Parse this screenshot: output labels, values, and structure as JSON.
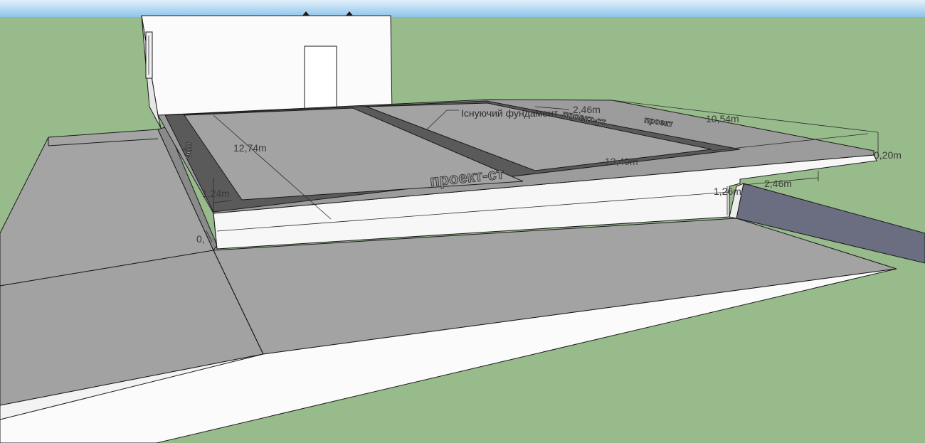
{
  "scene": {
    "colors": {
      "sky_top": "#e2f0fa",
      "sky_bottom": "#8ec3ea",
      "ground": "#97bb8b",
      "slab_top": "#9c9c9c",
      "slab_side": "#f7f7f7",
      "recess": "#a3a3a3",
      "border_strip": "#5a5a5a",
      "shadow_face": "#6b6e80",
      "wall": "#fbfbfb"
    }
  },
  "labels": {
    "leader_note": "Існуючий фундамент"
  },
  "dimensions": {
    "d_12_74": "12,74m",
    "d_2_46_top": "2,46m",
    "d_10_54": "10,54m",
    "d_0_20": "0,20m",
    "d_13_40": "13,40m",
    "d_1_24": "1,24m",
    "d_0_x": "0,",
    "d_1_26": "1,26m",
    "d_2_46_right": "2,46m"
  },
  "engraved_text": {
    "front": "проект-ст",
    "back": "проект-ст",
    "right": "проект",
    "left": "про"
  }
}
